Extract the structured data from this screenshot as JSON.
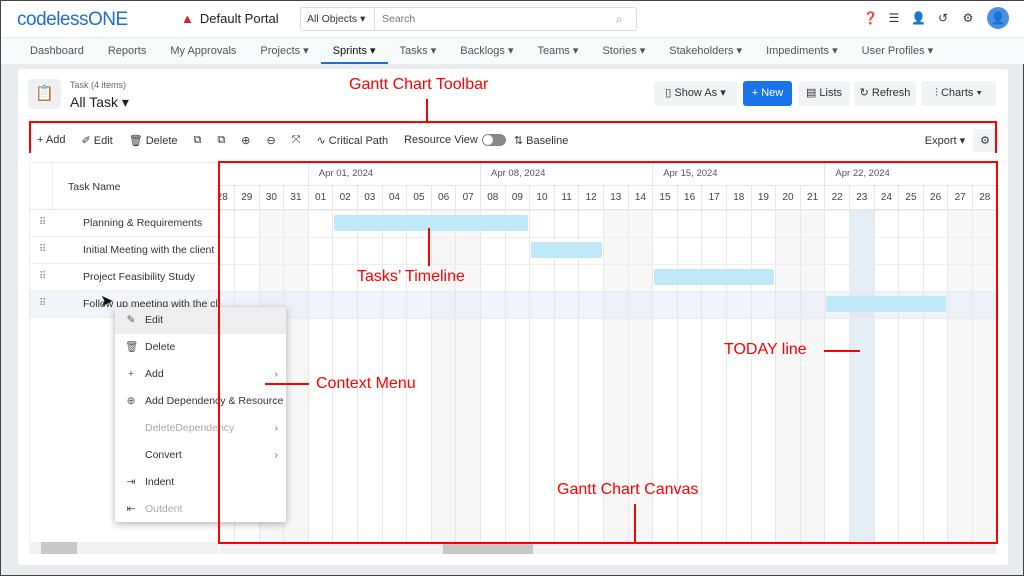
{
  "header": {
    "logo": "codelessONE",
    "portal": "Default Portal",
    "search_scope": "All Objects",
    "search_placeholder": "Search"
  },
  "nav": [
    "Dashboard",
    "Reports",
    "My Approvals",
    "Projects ▾",
    "Sprints ▾",
    "Tasks ▾",
    "Backlogs ▾",
    "Teams ▾",
    "Stories ▾",
    "Stakeholders ▾",
    "Impediments ▾",
    "User Profiles ▾"
  ],
  "nav_active": "Sprints ▾",
  "view": {
    "count_label": "Task (4 items)",
    "title": "All Task ▾",
    "show_as": "Show As ▾",
    "new": "+ New",
    "lists": "Lists",
    "refresh": "Refresh",
    "charts": "Charts ▾"
  },
  "toolbar": {
    "add": "Add",
    "edit": "Edit",
    "delete": "Delete",
    "critical_path": "Critical Path",
    "resource_view": "Resource View",
    "resource_view_on": false,
    "baseline": "Baseline",
    "export": "Export ▾"
  },
  "grid": {
    "column": "Task Name",
    "tasks": [
      {
        "name": "Planning & Requirements",
        "start": "2024-04-02",
        "end": "2024-04-09"
      },
      {
        "name": "Initial Meeting with the client",
        "start": "2024-04-10",
        "end": "2024-04-12"
      },
      {
        "name": "Project Feasibility Study",
        "start": "2024-04-15",
        "end": "2024-04-19"
      },
      {
        "name": "Follow up meeting with the cli...",
        "start": "2024-04-22",
        "end": "2024-04-26"
      }
    ]
  },
  "timeline": {
    "weeks": [
      {
        "label": "Apr 01, 2024",
        "date": "2024-04-01"
      },
      {
        "label": "Apr 08, 2024",
        "date": "2024-04-08"
      },
      {
        "label": "Apr 15, 2024",
        "date": "2024-04-15"
      },
      {
        "label": "Apr 22, 2024",
        "date": "2024-04-22"
      }
    ],
    "days": [
      "28",
      "29",
      "30",
      "31",
      "01",
      "02",
      "03",
      "04",
      "05",
      "06",
      "07",
      "08",
      "09",
      "10",
      "11",
      "12",
      "13",
      "14",
      "15",
      "16",
      "17",
      "18",
      "19",
      "20",
      "21",
      "22",
      "23",
      "24",
      "25",
      "26",
      "27",
      "28"
    ],
    "today": "2024-04-23",
    "today_color": "#e3eff5",
    "bar_color": "#bfe9f8"
  },
  "context_menu": [
    {
      "label": "Edit",
      "icon": "pencil-icon",
      "glyph": "✎",
      "enabled": true,
      "submenu": false
    },
    {
      "label": "Delete",
      "icon": "trash-icon",
      "glyph": "🗑",
      "enabled": true,
      "submenu": false
    },
    {
      "label": "Add",
      "icon": "plus-icon",
      "glyph": "+",
      "enabled": true,
      "submenu": true
    },
    {
      "label": "Add Dependency & Resource",
      "icon": "plus-circle-icon",
      "glyph": "⊕",
      "enabled": true,
      "submenu": false
    },
    {
      "label": "DeleteDependency",
      "icon": "",
      "glyph": "",
      "enabled": false,
      "submenu": true
    },
    {
      "label": "Convert",
      "icon": "",
      "glyph": "",
      "enabled": true,
      "submenu": true
    },
    {
      "label": "Indent",
      "icon": "indent-icon",
      "glyph": "⇥",
      "enabled": true,
      "submenu": false
    },
    {
      "label": "Outdent",
      "icon": "outdent-icon",
      "glyph": "⇤",
      "enabled": false,
      "submenu": false
    }
  ],
  "annotations": {
    "toolbar": "Gantt Chart Toolbar",
    "timeline": "Tasks’ Timeline",
    "today": "TODAY line",
    "context_menu": "Context Menu",
    "canvas": "Gantt Chart Canvas"
  }
}
